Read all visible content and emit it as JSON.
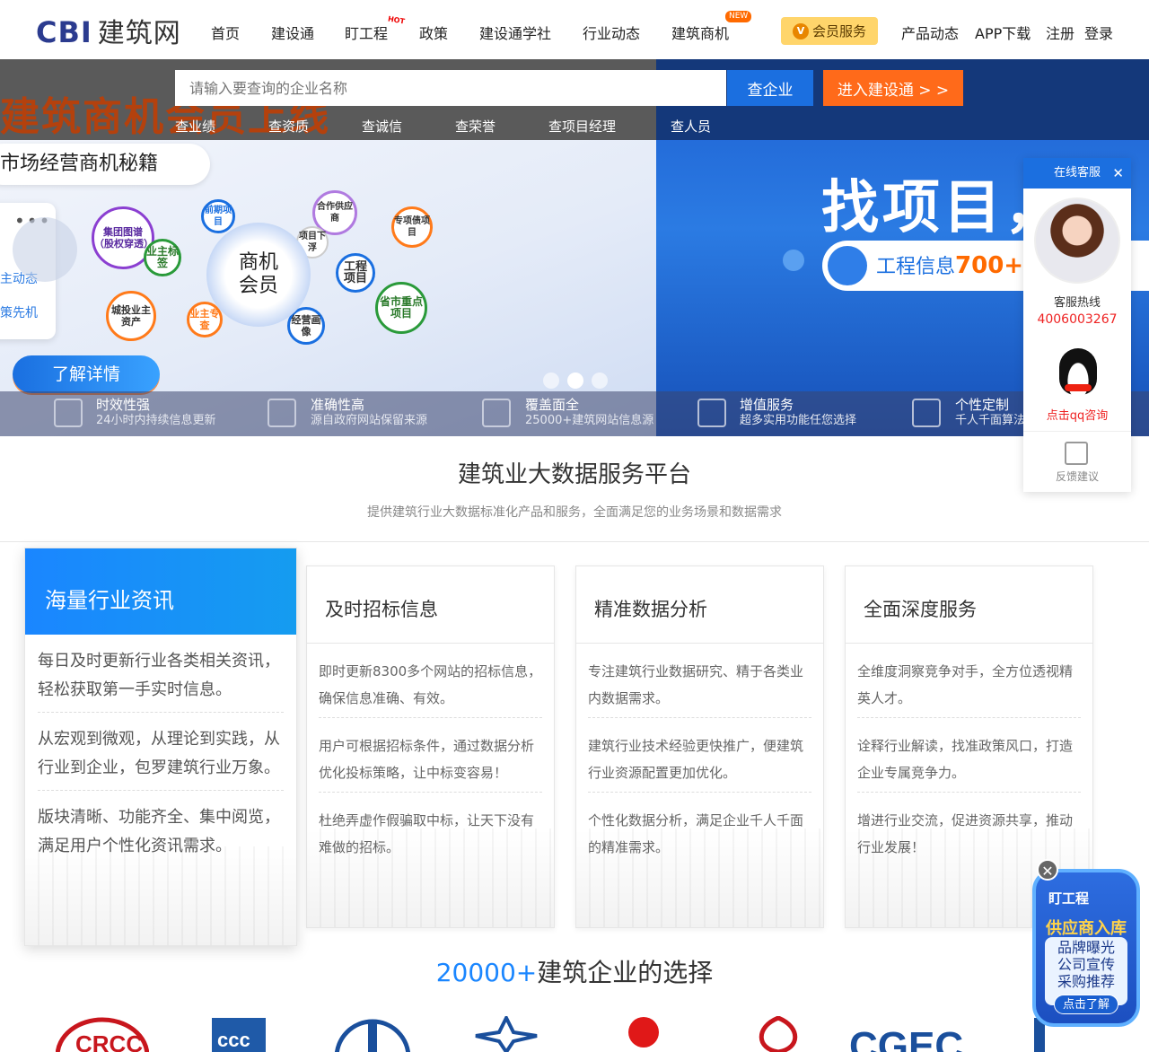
{
  "header": {
    "logo_cbi": "CBI",
    "logo_text": "建筑网",
    "nav": [
      "首页",
      "建设通",
      "盯工程",
      "政策",
      "建设通学社",
      "行业动态",
      "建筑商机"
    ],
    "hot_badge": "HOT",
    "new_badge": "NEW",
    "vip_label": "会员服务",
    "right_nav": [
      "产品动态",
      "APP下载",
      "注册",
      "登录"
    ]
  },
  "search": {
    "placeholder": "请输入要查询的企业名称",
    "search_btn": "查企业",
    "enter_btn": "进入建设通 > >",
    "tabs": [
      "查业绩",
      "查资质",
      "查诚信",
      "查荣誉",
      "查项目经理",
      "查人员"
    ]
  },
  "banner": {
    "promo": "建筑商机会员上线",
    "pill": "市场经营商机秘籍",
    "side_items": [
      "主动态",
      "策先机"
    ],
    "core": "商机\n会员",
    "bubbles": [
      "集团图谱（股权穿透）",
      "业主标签",
      "前期项目",
      "合作供应商",
      "项目下浮",
      "专项债项目",
      "工程项目",
      "省市重点项目",
      "城投业主资产",
      "业主专查",
      "经营画像"
    ],
    "learn_more": "了解详情",
    "right_title": "找项目，",
    "right_pill_text": "工程信息",
    "right_pill_num": "700+"
  },
  "features": [
    {
      "title": "时效性强",
      "desc": "24小时内持续信息更新"
    },
    {
      "title": "准确性高",
      "desc": "源自政府网站保留来源"
    },
    {
      "title": "覆盖面全",
      "desc": "25000+建筑网站信息源"
    },
    {
      "title": "增值服务",
      "desc": "超多实用功能任您选择"
    },
    {
      "title": "个性定制",
      "desc": "千人千面算法"
    }
  ],
  "service": {
    "title": "在线客服",
    "close": "✕",
    "hotline_label": "客服热线",
    "hotline": "4006003267",
    "qq": "点击qq咨询",
    "feedback": "反馈建议"
  },
  "section": {
    "title": "建筑业大数据服务平台",
    "subtitle": "提供建筑行业大数据标准化产品和服务，全面满足您的业务场景和数据需求"
  },
  "cards": [
    {
      "title": "海量行业资讯",
      "items": [
        "每日及时更新行业各类相关资讯，轻松获取第一手实时信息。",
        "从宏观到微观，从理论到实践，从行业到企业，包罗建筑行业万象。",
        "版块清晰、功能齐全、集中阅览，满足用户个性化资讯需求。"
      ]
    },
    {
      "title": "及时招标信息",
      "items": [
        "即时更新8300多个网站的招标信息，确保信息准确、有效。",
        "用户可根据招标条件，通过数据分析优化投标策略，让中标变容易！",
        "杜绝弄虚作假骗取中标，让天下没有难做的招标。"
      ]
    },
    {
      "title": "精准数据分析",
      "items": [
        "专注建筑行业数据研究、精于各类业内数据需求。",
        "建筑行业技术经验更快推广，便建筑行业资源配置更加优化。",
        "个性化数据分析，满足企业千人千面的精准需求。"
      ]
    },
    {
      "title": "全面深度服务",
      "items": [
        "全维度洞察竞争对手，全方位透视精英人才。",
        "诠释行业解读，找准政策风口，打造企业专属竞争力。",
        "增进行业交流，促进资源共享，推动行业发展！"
      ]
    }
  ],
  "brands": {
    "count": "20000+",
    "label": "建筑企业的选择",
    "logos": [
      "crcc-logo",
      "cscec-logo",
      "crec-logo",
      "cccc-logo",
      "red-logo",
      "power-logo",
      "cgec-logo",
      "blue-logo"
    ]
  },
  "floater": {
    "close": "✕",
    "brand": "盯工程",
    "title": "供应商入库",
    "lines": [
      "品牌曝光",
      "公司宣传",
      "采购推荐"
    ],
    "button": "点击了解"
  },
  "colors": {
    "primary": "#1b6fe0",
    "accent": "#ff6a1a",
    "vip": "#ffd56b"
  }
}
